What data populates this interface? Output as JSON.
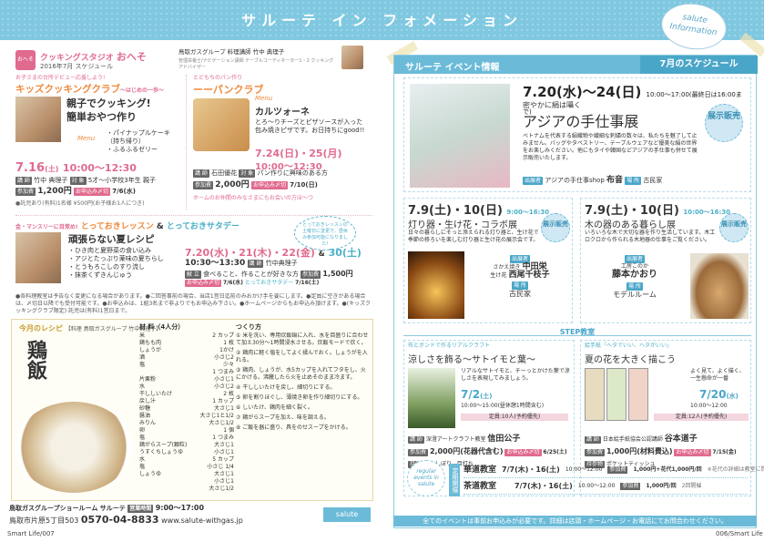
{
  "header": {
    "title": "サルーテ イン フォメーション",
    "tag": "salute Information"
  },
  "left": {
    "cooking": {
      "brand": "クッキングスタジオ",
      "brand2": "おへそ",
      "sub": "2016年7月 スケジュール",
      "logo": "おへそ",
      "profile": "鳥取ガスグループ 料理講師 竹中 典理子",
      "profile_sub": "管理栄養士/ナビゲーション講師 テーブルコーディネーター1・2 クッキングアドバイザー",
      "kids_tag": "お子さまの台所デビュー応援しよう!",
      "kids_title": "キッズクッキングクラブ",
      "kids_sub": "〜はじめの一歩〜",
      "kids_head": "親子でクッキング!",
      "kids_head2": "簡単おやつ作り",
      "menu_label": "Menu",
      "menu": [
        "・パイナップルケーキ",
        "（持ち帰り）",
        "・ふるふるゼリー"
      ],
      "kids_date": "7.16",
      "kids_day": "(土)",
      "kids_time": "10:00〜12:30",
      "kids_teacher_label": "講 師",
      "kids_teacher": "竹中 典理子",
      "kids_target_label": "対 象",
      "kids_target": "5才〜小学校3年生 親子",
      "kids_fee_label": "参加費",
      "kids_fee": "1,200円",
      "kids_deadline_label": "お申込み〆切",
      "kids_deadline": "7/6(水)",
      "kids_note": "●託児あり(有料)1名様 ¥500円(お子様お1人につき)",
      "bread_tag": "とどもちのパン作り",
      "bread_title": "ーーパンクラブ",
      "bread_menu_label": "Menu",
      "bread_name": "カルツォーネ",
      "bread_desc": "とろ〜りチーズとピザソースが入った包み焼きピザです。お日持ちにgood!!",
      "bread_date": "7.24(日)・25(月)",
      "bread_time": "10:00〜12:30",
      "bread_teacher_label": "講 師",
      "bread_teacher": "石田優花",
      "bread_target_label": "対 象",
      "bread_target": "パン作りに興味のある方",
      "bread_fee_label": "参加費",
      "bread_fee": "2,000円",
      "bread_deadline_label": "お申込み〆切",
      "bread_deadline": "7/10(日)",
      "bread_note": "ホームのお仲間のみなさまにもお会いの方ほ〜つ"
    },
    "lesson": {
      "tag": "金・マンスリーに目覚め!",
      "title1": "とっておきレッスン",
      "amp": "&",
      "title2": "とっておきサタデー",
      "title": "頑張らない夏レシピ",
      "items": [
        "・ひき肉と夏野菜の食い込み",
        "・アジとたっぷり薬味の夏ちらし",
        "・とうもろこしのすり流し",
        "・抹茶くずきんじゅう"
      ],
      "date": "7.20(水)・21(木)・22(金)",
      "and": "&",
      "date2": "30(土)",
      "time": "10:30〜13:30",
      "teacher_label": "講 師",
      "teacher": "竹中典理子",
      "menu_label": "献 立",
      "menu": "食べること、作ることが好きな方",
      "fee_label": "参加費",
      "fee": "1,500円",
      "deadline_label": "お申込み〆切",
      "deadline": "7/6(水)",
      "deadline2_label": "とっておきサタデー",
      "deadline2": "7/16(土)",
      "circle": "とっておきレッスンの土曜日に変更で、昼休み参加可能になりました!"
    },
    "notes": "●各料理教室は予告なく変更になる場合があります。●ご回答事前の場合、当店1営日迄前のみおかけ手を要にします。●定員に空きがある場合は、〆切日以降でも受付可能です。●お申込みは、1組3名まで非よりでもお申込み下さい。●ホームページからもお申込み頂けます。●(キッズクッキングクラブ限定) 託児は(有料)1営日まで。",
    "recipe": {
      "tag": "今月のレシピ",
      "credit": "【料理 鳥取ガスグループ 竹中典理子】",
      "title": "鶏飯",
      "ing_head": "材 料（4人分）",
      "steps_head": "つくり方",
      "ingredients": [
        [
          "米",
          "2 カップ"
        ],
        [
          "鶏もも肉",
          "1 枚"
        ],
        [
          "しょうが",
          "1かけ"
        ],
        [
          "酒",
          "小さじ2"
        ],
        [
          "塩",
          "少々"
        ],
        [
          "",
          "1 つまみ"
        ],
        [
          "片栗粉",
          "小さじ1"
        ],
        [
          "水",
          "小さじ2"
        ],
        [
          "干ししいたけ",
          "2 枚"
        ],
        [
          "戻し汁",
          "1 カップ"
        ],
        [
          "砂糖",
          "大さじ1"
        ],
        [
          "醤油",
          "大さじ1と1/2"
        ],
        [
          "みりん",
          "大さじ1/2"
        ],
        [
          "卵",
          "1 個"
        ],
        [
          "塩",
          "1 つまみ"
        ],
        [
          "鶏がらスープ(顆粒)",
          "大さじ1"
        ],
        [
          "うすくちしょうゆ",
          "小さじ1"
        ],
        [
          "水",
          "5 カップ"
        ],
        [
          "塩",
          "小さじ 1/4"
        ],
        [
          "しょうゆ",
          "大さじ1"
        ],
        [
          "",
          "小さじ1"
        ],
        [
          "",
          "大さじ1/2"
        ]
      ],
      "steps": [
        "① 米を洗い、専用炊飯鍋に入れ、水を目盛りに合わせて加え30分〜1時間浸水させる。炊飯モードで炊く。",
        "② 鶏肉に軽く塩をしてよく揉んでおく。しょうがを入れる。",
        "③ 鶏肉、しょうが、水5カップを入れてフタをし、火にかける。沸騰したら火を止めそのまま冷ます。",
        "④ 干ししいたけを戻し、細切りにする。",
        "⑤ 卵を割りほぐし、薄焼き卵を作り細切りにする。",
        "⑥ しいたけ、鶏肉を細く裂く。",
        "⑦ 鶏がらスープを加え、味を調える。",
        "⑧ ご飯を器に盛り、具をのせスープをかける。"
      ]
    },
    "shop": {
      "name": "鳥取ガスグループショールーム サルーテ",
      "hours_label": "営業時間",
      "hours": "9:00〜17:00",
      "address": "鳥取市片原5丁目503",
      "tel": "0570-04-8833",
      "web": "www.salute-withgas.jp",
      "logo": "salute"
    },
    "page": "Smart Life/007"
  },
  "right": {
    "header": "サルーテ イベント情報",
    "schedule": "7月のスケジュール",
    "ev1": {
      "date": "7.20(水)〜24(日)",
      "time": "10:00〜17:00(最終日は16:00まで)",
      "sub": "密やかに絹は囁く",
      "title": "アジアの手仕事展",
      "badge": "展示販売",
      "desc": "ベトナムを代表する絹織物や繊細な刺繍の数々は、私たちを魅了して止みません。バッグやタペストリー、テーブルウェアなど優美な絹の世界をお楽しみください。他にもタイや韓国などアジアの手仕事も併せて展示販売いたします。",
      "exhibitor_label": "出展者",
      "exhibitor": "アジアの手仕事shop",
      "exhibitor_name": "布音",
      "place_label": "場 所",
      "place": "古民家"
    },
    "ev2": {
      "date": "7.9(土)・10(日)",
      "time": "9:00〜16:30",
      "title": "灯り器・生け花・コラボ展",
      "badge": "展示販売",
      "desc": "日々の暮らしにそっと添えられる灯り器と、生け花で季節の移ろいを楽しむ灯り器と生け花の展示会です。",
      "exhibitor_label": "出展者",
      "ex1_role": "さかえ焼き",
      "ex1": "中田栄",
      "ex2_role": "生け花",
      "ex2": "西尾千枝子",
      "place_label": "場 所",
      "place": "古民家"
    },
    "ev3": {
      "date": "7.9(土)・10(日)",
      "time": "10:00〜16:30",
      "title": "木の器のある暮らし展",
      "badge": "展示販売",
      "desc": "いろいろな木で大切な器を作り生活しています。木工ロクロから作られる木地器の仕事をご覧ください。",
      "exhibitor_label": "出展者",
      "ex_role": "工房このか",
      "ex": "藤本かおり",
      "place_label": "場 所",
      "place": "モデルルーム"
    },
    "step": "STEP教室",
    "st1": {
      "tag": "布とボンドで作るリアルクラフト",
      "title": "涼しさを飾る〜サトイモと葉〜",
      "desc": "リアルなサトイモと、チーっとかけた葉で涼しさを表現してみましょう。",
      "date": "7/2",
      "day": "(土)",
      "time": "10:00〜15:00(昼休憩1時間含む)",
      "capacity": "定員:10人(予約優先)",
      "teacher_label": "講 師",
      "teacher": "深澄アートクラフト教室",
      "teacher_name": "信田公子",
      "fee_label": "参加費",
      "fee": "2,000円(花器代含む)",
      "deadline_label": "お申込み〆切",
      "deadline": "6/25(土)",
      "bring_label": "持参物",
      "bring": "おしぼり、目打ち"
    },
    "st2": {
      "tag": "絵手紙「へタでいい、ヘタがいい」",
      "title": "夏の花を大きく描こう",
      "desc": "よく見て、よく描く、一生懸命が一番",
      "date": "7/20",
      "day": "(水)",
      "time": "10:00〜12:00",
      "capacity": "定員:12人(予約優先)",
      "teacher_label": "講 師",
      "teacher": "日本絵手紙協会公認講師",
      "teacher_name": "谷本道子",
      "fee_label": "参加費",
      "fee": "1,000円(材料費込)",
      "deadline_label": "お申込み〆切",
      "deadline": "7/15(金)",
      "bring_label": "持参物",
      "bring": "ポケットティッシュ"
    },
    "regular": {
      "label": "regular events in salute",
      "side": "定期開催",
      "rows": [
        {
          "name": "華道教室",
          "dates": "7/7(木)・16(土)",
          "time": "10:00〜12:00",
          "fee_label": "参加費",
          "fee": "1,000円+花代1,000円/回",
          "note": "※花代の詳細は教室に問い合わせください"
        },
        {
          "name": "茶道教室",
          "dates": "7/7(木)・16(土)",
          "time": "10:00〜12:00",
          "fee_label": "参加費",
          "fee": "1,000円/回",
          "note": "2回開催"
        }
      ]
    },
    "footer": "全てのイベントは事前お申込みが必要です。詳細は店頭・ホームページ・お電話にてお問合わせください。",
    "page": "006/Smart Life"
  }
}
